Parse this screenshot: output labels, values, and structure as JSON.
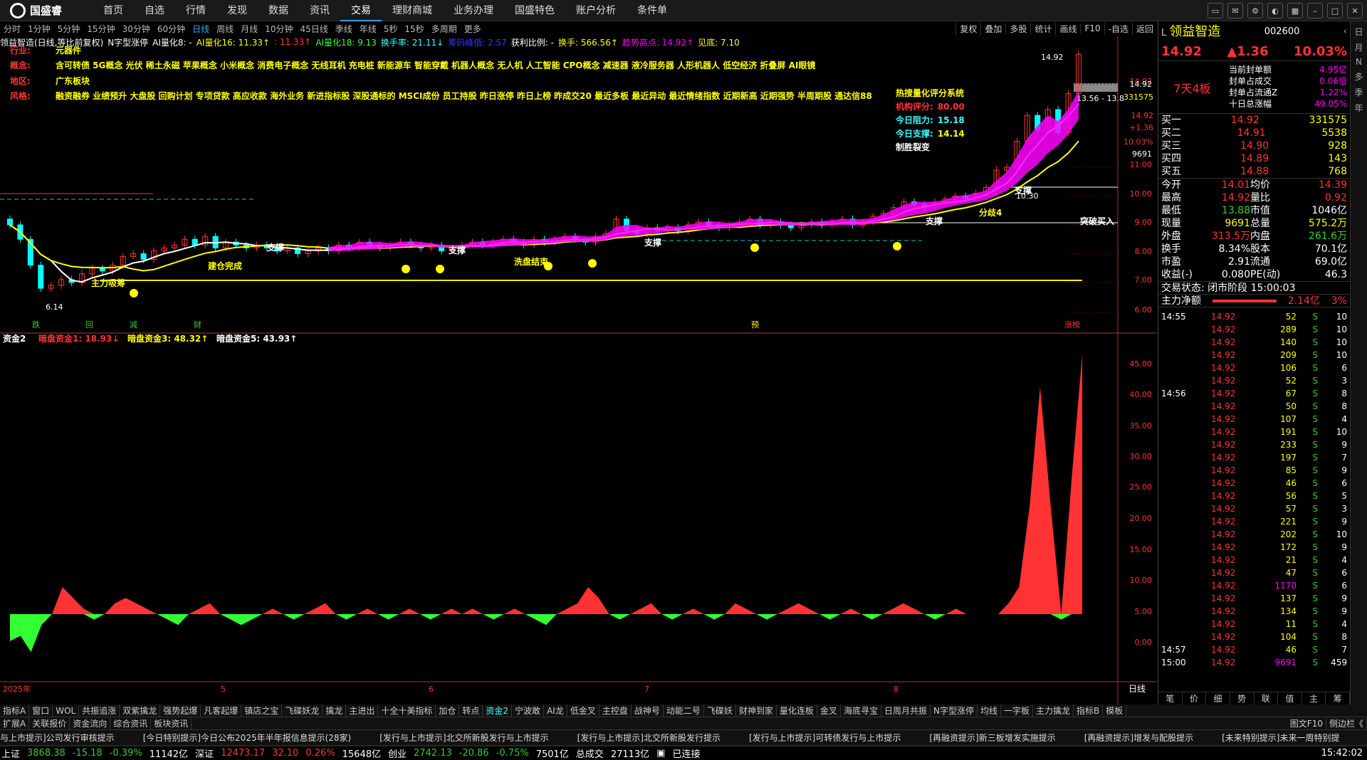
{
  "app": {
    "name": "国盛睿",
    "menu": [
      "首页",
      "自选",
      "行情",
      "发现",
      "数据",
      "资讯",
      "交易",
      "理财商城",
      "业务办理",
      "国盛特色",
      "账户分析",
      "条件单"
    ],
    "active_menu": "交易"
  },
  "timeframes": [
    "分时",
    "1分钟",
    "5分钟",
    "15分钟",
    "30分钟",
    "60分钟",
    "日线",
    "周线",
    "月线",
    "10分钟",
    "45日线",
    "季线",
    "年线",
    "5秒",
    "15秒",
    "多周期",
    "更多"
  ],
  "active_tf": "日线",
  "tools": [
    "复权",
    "叠加",
    "多股",
    "统计",
    "画线",
    "F10",
    "-自选",
    "返回"
  ],
  "indicator_line": [
    {
      "t": "领益智造(日线,等比前复权)",
      "c": "#fff"
    },
    {
      "t": "N字型涨停",
      "c": "#fff"
    },
    {
      "t": "AI量化8: -",
      "c": "#fff"
    },
    {
      "t": "AI量化16: 11.33↑",
      "c": "#ff0"
    },
    {
      "t": ": 11.33↑",
      "c": "#f33"
    },
    {
      "t": "AI量化18: 9.13",
      "c": "#3f3"
    },
    {
      "t": "换手率: 21.11↓",
      "c": "#3ff"
    },
    {
      "t": "筹码峰值: 2.57",
      "c": "#33f"
    },
    {
      "t": "获利比例: -",
      "c": "#fff"
    },
    {
      "t": "换手: 566.56↑",
      "c": "#ff0"
    },
    {
      "t": "趋势高点: 14.92↑",
      "c": "#f0f"
    },
    {
      "t": "见底: 7.10",
      "c": "#ff0"
    }
  ],
  "info": [
    {
      "k": "行业:",
      "v": "元器件"
    },
    {
      "k": "概念:",
      "v": "含可转债 5G概念 光伏 稀土永磁 苹果概念 小米概念 消费电子概念 无线耳机 充电桩 新能源车 智能穿戴 机器人概念 无人机 人工智能 CPO概念 减速器 液冷服务器 人形机器人 低空经济 折叠屏 AI眼镜"
    },
    {
      "k": "地区:",
      "v": "广东板块"
    },
    {
      "k": "风格:",
      "v": "融资融券 业绩预升 大盘股 回购计划 专项贷款 高应收款 海外业务 新进指标股 深股通标的 MSCI成份 员工持股 昨日涨停 昨日上榜 昨成交20 最近多板 最近异动 最近情绪指数 近期新高 近期强势 半周期股 通达信88"
    }
  ],
  "score": {
    "title": "热搜量化评分系统",
    "items": [
      {
        "k": "机构评分:",
        "v": "80.00"
      },
      {
        "k": "今日阻力:",
        "v": "15.18"
      },
      {
        "k": "今日支撑:",
        "v": "14.14"
      }
    ],
    "tag": "制胜裂变"
  },
  "annotations": [
    "支撑",
    "支撑",
    "支撑",
    "支撑",
    "支撑",
    "建仓完成",
    "洗盘结束",
    "主力吸筹",
    "分歧4",
    "突破买入"
  ],
  "price_axis": [
    "14.92",
    "11.00",
    "10.00",
    "9.00",
    "8.00",
    "7.00",
    "6.00"
  ],
  "price_tags": {
    "last": "14.92",
    "vol": "331575",
    "chg": "+1.36",
    "tag2": "14.92",
    "pct": "10.03%",
    "t4": "9691",
    "range": "13.56 - 13.8",
    "h": "14.92",
    "low": "6.14",
    "lvl": "10.30"
  },
  "lower_title": [
    {
      "t": "资金2",
      "c": "#fff"
    },
    {
      "t": "暗盘资金1: 18.93↓",
      "c": "#f33"
    },
    {
      "t": "暗盘资金3: 48.32↑",
      "c": "#ff0"
    },
    {
      "t": "暗盘资金5: 43.93↑",
      "c": "#fff"
    }
  ],
  "lower_axis": [
    "45.00",
    "40.00",
    "35.00",
    "30.00",
    "25.00",
    "20.00",
    "15.00",
    "10.00",
    "5.00",
    "0.00"
  ],
  "xaxis": [
    "2025年",
    "5",
    "6",
    "7",
    "8"
  ],
  "xaxis_label": "日线",
  "event_marks": [
    "跌",
    "回",
    "减",
    "财",
    "预",
    "涨榜"
  ],
  "stock": {
    "name": "领益智造",
    "code": "002600",
    "price": "14.92",
    "chg": "▲1.36",
    "pct": "10.03%",
    "board": "7天4板",
    "seal": [
      {
        "k": "当前封单额",
        "v": "4.95亿"
      },
      {
        "k": "封单占成交",
        "v": "0.06倍"
      },
      {
        "k": "封单占流通Z",
        "v": "1.22%"
      },
      {
        "k": "十日总涨幅",
        "v": "49.05%"
      }
    ]
  },
  "orderbook": [
    {
      "k": "买一",
      "p": "14.92",
      "v": "331575"
    },
    {
      "k": "买二",
      "p": "14.91",
      "v": "5538"
    },
    {
      "k": "买三",
      "p": "14.90",
      "v": "928"
    },
    {
      "k": "买四",
      "p": "14.89",
      "v": "143"
    },
    {
      "k": "买五",
      "p": "14.88",
      "v": "768"
    }
  ],
  "quote": [
    [
      "今开",
      "14.01",
      "均价",
      "14.39"
    ],
    [
      "最高",
      "14.92",
      "量比",
      "0.92"
    ],
    [
      "最低",
      "13.88",
      "市值",
      "1046亿"
    ],
    [
      "现量",
      "9691",
      "总量",
      "575.2万"
    ],
    [
      "外盘",
      "313.5万",
      "内盘",
      "261.6万"
    ],
    [
      "换手",
      "8.34%",
      "股本",
      "70.1亿"
    ],
    [
      "市盈",
      "2.91",
      "流通",
      "69.0亿"
    ],
    [
      "收益(-)",
      "0.080",
      "PE(动)",
      "46.3"
    ]
  ],
  "trade_state": "交易状态: 闭市阶段 15:00:03",
  "main_net": {
    "k": "主力净额",
    "v": "2.14亿",
    "p": "3%"
  },
  "ticks": [
    [
      "14:55",
      "14.92",
      "52",
      "S",
      "10"
    ],
    [
      "",
      "14.92",
      "289",
      "S",
      "10"
    ],
    [
      "",
      "14.92",
      "140",
      "S",
      "10"
    ],
    [
      "",
      "14.92",
      "209",
      "S",
      "10"
    ],
    [
      "",
      "14.92",
      "106",
      "S",
      "6"
    ],
    [
      "",
      "14.92",
      "52",
      "S",
      "3"
    ],
    [
      "14:56",
      "14.92",
      "67",
      "S",
      "8"
    ],
    [
      "",
      "14.92",
      "50",
      "S",
      "8"
    ],
    [
      "",
      "14.92",
      "107",
      "S",
      "4"
    ],
    [
      "",
      "14.92",
      "191",
      "S",
      "10"
    ],
    [
      "",
      "14.92",
      "233",
      "S",
      "9"
    ],
    [
      "",
      "14.92",
      "197",
      "S",
      "7"
    ],
    [
      "",
      "14.92",
      "85",
      "S",
      "9"
    ],
    [
      "",
      "14.92",
      "46",
      "S",
      "6"
    ],
    [
      "",
      "14.92",
      "56",
      "S",
      "5"
    ],
    [
      "",
      "14.92",
      "57",
      "S",
      "3"
    ],
    [
      "",
      "14.92",
      "221",
      "S",
      "9"
    ],
    [
      "",
      "14.92",
      "202",
      "S",
      "10"
    ],
    [
      "",
      "14.92",
      "172",
      "S",
      "9"
    ],
    [
      "",
      "14.92",
      "21",
      "S",
      "4"
    ],
    [
      "",
      "14.92",
      "47",
      "S",
      "6"
    ],
    [
      "",
      "14.92",
      "1170",
      "S",
      "6"
    ],
    [
      "",
      "14.92",
      "137",
      "S",
      "9"
    ],
    [
      "",
      "14.92",
      "134",
      "S",
      "9"
    ],
    [
      "",
      "14.92",
      "11",
      "S",
      "4"
    ],
    [
      "",
      "14.92",
      "104",
      "S",
      "8"
    ],
    [
      "14:57",
      "14.92",
      "46",
      "S",
      "7"
    ],
    [
      "15:00",
      "14.92",
      "9691",
      "S",
      "459"
    ]
  ],
  "rp_tabs": [
    "笔",
    "价",
    "细",
    "势",
    "联",
    "值",
    "主",
    "筹"
  ],
  "side_tabs": [
    "日",
    "月",
    "N",
    "多",
    "季",
    "年"
  ],
  "btabs": [
    "指标A",
    "窗口",
    "WOL",
    "共振追涨",
    "双紫擒龙",
    "强势起爆",
    "凡客起爆",
    "镇店之宝",
    "飞碟妖龙",
    "擒龙",
    "主进出",
    "十全十美指标",
    "加仓",
    "转点",
    "资金2",
    "宁波敢",
    "AI龙",
    "低金叉",
    "主控盘",
    "战神号",
    "动能二号",
    "飞碟妖",
    "财神到家",
    "量化连板",
    "金叉",
    "海底寻宝",
    "日周月共振",
    "N字型涨停",
    "均线",
    "一字板",
    "主力擒龙",
    "指标B",
    "模板"
  ],
  "btabs2": [
    "扩展A",
    "关联报价",
    "资金流向",
    "综合资讯",
    "板块资讯"
  ],
  "f10": "图文F10",
  "sidebar_toggle": "侧边栏《",
  "news": [
    "与上市提示]公司发行审核提示",
    "[今日特别提示]今日公布2025年半年报信息提示(28家)",
    "[发行与上市提示]北交所新股发行与上市提示",
    "[发行与上市提示]北交所新股发行提示",
    "[发行与上市提示]可转债发行与上市提示",
    "[再融资提示]新三板增发实施提示",
    "[再融资提示]增发与配股提示",
    "[未来特别提示]未来一周特别提"
  ],
  "status": {
    "sh": "上证",
    "sh_v": "3868.38",
    "sh_c": "-15.18",
    "sh_p": "-0.39%",
    "sh_a": "11142亿",
    "sz": "深证",
    "sz_v": "12473.17",
    "sz_c": "32.10",
    "sz_p": "0.26%",
    "sz_a": "15648亿",
    "cy": "创业",
    "cy_v": "2742.13",
    "cy_c": "-20.86",
    "cy_p": "-0.75%",
    "cy_a": "7501亿",
    "tot": "总成交",
    "tot_v": "27113亿",
    "conn": "已连接",
    "time": "15:42:02"
  },
  "colors": {
    "up": "#ff3333",
    "down": "#33cc33",
    "ma_white": "#ffffff",
    "ma_yellow": "#ffff00",
    "band": "#ff00ff"
  }
}
